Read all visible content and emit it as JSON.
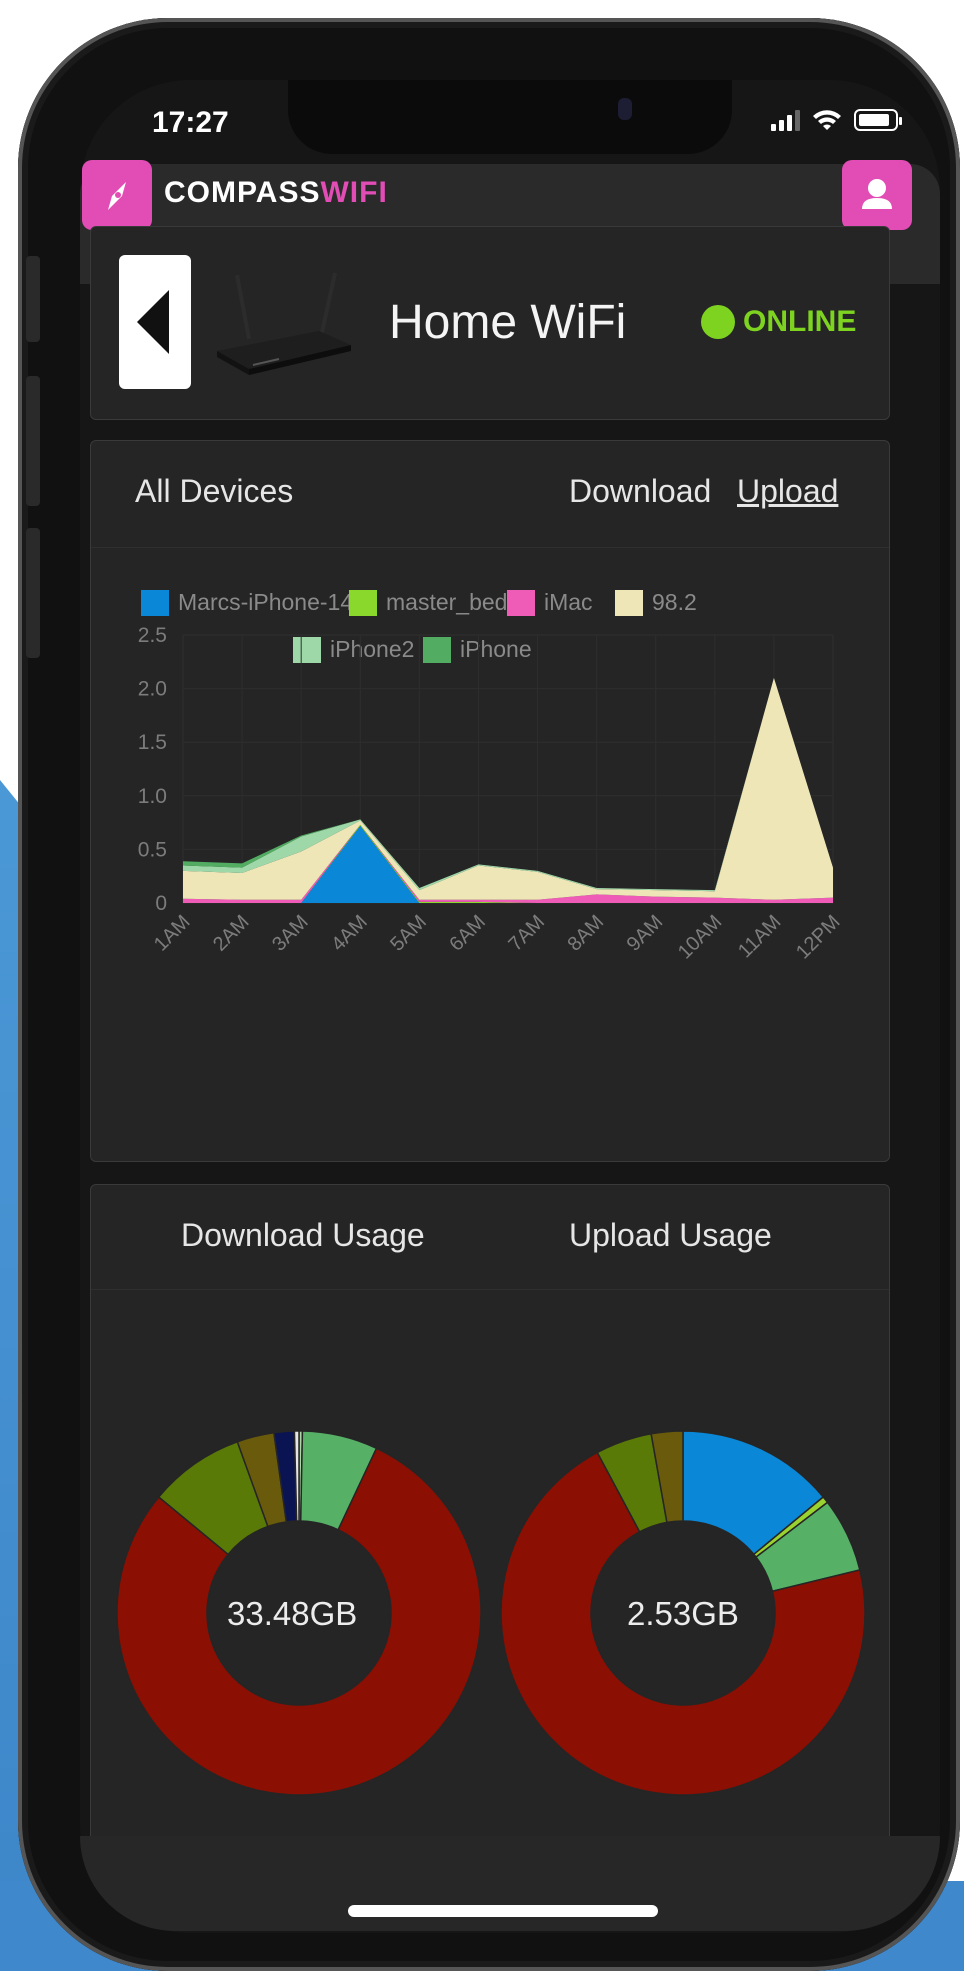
{
  "status_bar": {
    "time": "17:27"
  },
  "app": {
    "logo_main": "COMPASS",
    "logo_accent": "WIFI"
  },
  "device_card": {
    "title": "Home WiFi",
    "status": "ONLINE",
    "status_color": "#7ed321"
  },
  "usage_chart": {
    "filter_label": "All Devices",
    "download_label": "Download",
    "upload_label": "Upload",
    "legend": [
      {
        "name": "Marcs-iPhone-14",
        "color": "#0a87d6"
      },
      {
        "name": "master_bed",
        "color": "#8bd82c"
      },
      {
        "name": "iMac",
        "color": "#ee5cb8"
      },
      {
        "name": "98.2",
        "color": "#efe6b8"
      },
      {
        "name": "iPhone2",
        "color": "#9fd8a8"
      },
      {
        "name": "iPhone",
        "color": "#52ad62"
      }
    ]
  },
  "chart_data": [
    {
      "type": "area",
      "stacked": true,
      "categories": [
        "1AM",
        "2AM",
        "3AM",
        "4AM",
        "5AM",
        "6AM",
        "7AM",
        "8AM",
        "9AM",
        "10AM",
        "11AM",
        "12PM"
      ],
      "y_ticks": [
        "0",
        "0.5",
        "1.0",
        "1.5",
        "2.0",
        "2.5"
      ],
      "ylim": [
        0,
        2.5
      ],
      "grid": true,
      "legend_position": "top",
      "series": [
        {
          "name": "Marcs-iPhone-14",
          "values": [
            0,
            0,
            0,
            0.72,
            0,
            0,
            0,
            0,
            0,
            0,
            0,
            0
          ]
        },
        {
          "name": "master_bed",
          "values": [
            0,
            0,
            0,
            0.01,
            0.01,
            0.01,
            0,
            0,
            0,
            0,
            0,
            0
          ]
        },
        {
          "name": "iMac",
          "values": [
            0.04,
            0.03,
            0.03,
            0,
            0.02,
            0.02,
            0.03,
            0.08,
            0.06,
            0.05,
            0.03,
            0.05
          ]
        },
        {
          "name": "98.2",
          "values": [
            0.26,
            0.25,
            0.45,
            0.04,
            0.09,
            0.32,
            0.26,
            0.05,
            0.06,
            0.06,
            2.07,
            0.28
          ]
        },
        {
          "name": "iPhone2",
          "values": [
            0.05,
            0.05,
            0.14,
            0.01,
            0.02,
            0.01,
            0.01,
            0.01,
            0.01,
            0.01,
            0,
            0
          ]
        },
        {
          "name": "iPhone",
          "values": [
            0.04,
            0.04,
            0.01,
            0,
            0,
            0,
            0,
            0,
            0,
            0,
            0,
            0
          ]
        }
      ]
    },
    {
      "type": "pie",
      "title": "Download Usage",
      "center_label": "33.48GB",
      "slices": [
        {
          "value": 0.3,
          "color": "#a9d6a2"
        },
        {
          "value": 6.7,
          "color": "#56b066"
        },
        {
          "value": 79.0,
          "color": "#8b0f02"
        },
        {
          "value": 8.5,
          "color": "#5a7a07"
        },
        {
          "value": 3.3,
          "color": "#6a5a0c"
        },
        {
          "value": 1.8,
          "color": "#0b1452"
        },
        {
          "value": 0.4,
          "color": "#e6e6e6"
        }
      ]
    },
    {
      "type": "pie",
      "title": "Upload Usage",
      "center_label": "2.53GB",
      "slices": [
        {
          "value": 14.0,
          "color": "#0a87d6"
        },
        {
          "value": 0.6,
          "color": "#9ad22f"
        },
        {
          "value": 6.6,
          "color": "#56b066"
        },
        {
          "value": 71.0,
          "color": "#8b0f02"
        },
        {
          "value": 5.0,
          "color": "#5a7a07"
        },
        {
          "value": 2.8,
          "color": "#6a5a0c"
        }
      ]
    }
  ]
}
